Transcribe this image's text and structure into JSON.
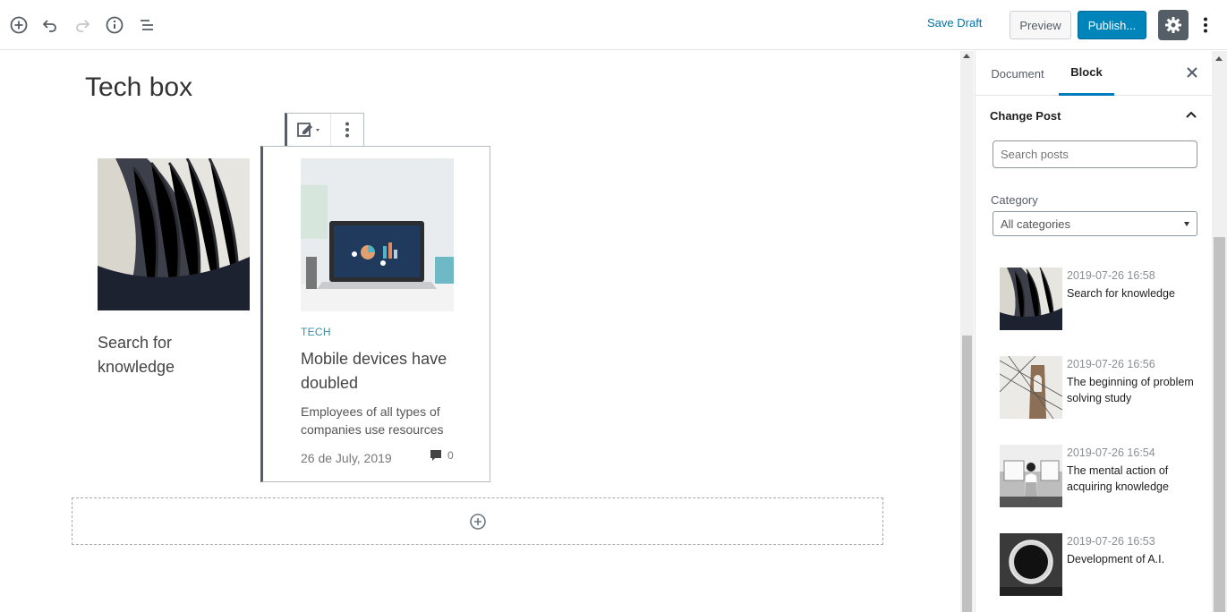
{
  "toolbar": {
    "add_icon": "plus-circle-icon",
    "undo_icon": "undo-icon",
    "redo_icon": "redo-icon",
    "info_icon": "info-icon",
    "outline_icon": "list-icon",
    "save_draft_label": "Save Draft",
    "preview_label": "Preview",
    "publish_label": "Publish...",
    "settings_icon": "gear-icon",
    "more_icon": "vertical-ellipsis-icon"
  },
  "editor": {
    "post_title": "Tech box",
    "card1": {
      "title": "Search for knowledge"
    },
    "card2": {
      "category": "TECH",
      "title": "Mobile devices have doubled",
      "excerpt": "Employees of all types of companies use resources",
      "date": "26 de July, 2019",
      "comment_count": "0"
    },
    "block_toolbar": {
      "switch_icon": "edit-post-icon",
      "more_icon": "vertical-ellipsis-icon"
    },
    "appender_icon": "plus-circle-icon"
  },
  "sidebar": {
    "tabs": [
      {
        "label": "Document",
        "active": false
      },
      {
        "label": "Block",
        "active": true
      }
    ],
    "close_icon": "close-icon",
    "panel": {
      "title": "Change Post",
      "search_placeholder": "Search posts",
      "category_label": "Category",
      "category_selected": "All categories",
      "posts": [
        {
          "date": "2019-07-26 16:58",
          "title": "Search for knowledge"
        },
        {
          "date": "2019-07-26 16:56",
          "title": "The beginning of problem solving study"
        },
        {
          "date": "2019-07-26 16:54",
          "title": "The mental action of acquiring knowledge"
        },
        {
          "date": "2019-07-26 16:53",
          "title": "Development of A.I."
        }
      ]
    }
  },
  "colors": {
    "accent": "#0085ba",
    "link": "#0073aa",
    "tab_active": "#007cba",
    "settings_bg": "#555d66",
    "category": "#3b8ea5"
  }
}
